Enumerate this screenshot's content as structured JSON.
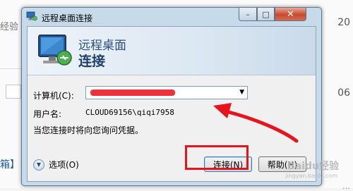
{
  "background": {
    "left_text_1": "经验",
    "left_text_2": "箱】",
    "right_text_1": "20",
    "right_text_2": "06",
    "right_text_3": "…"
  },
  "dialog": {
    "title": "远程桌面连接",
    "titlebar_buttons": {
      "minimize": "–",
      "maximize": "□",
      "close": "✕"
    },
    "banner": {
      "line1": "远程桌面",
      "line2": "连接"
    },
    "computer_label": "计算机(C):",
    "computer_value": "",
    "username_label": "用户名:",
    "username_value": "CLOUD69156\\qiqi7958",
    "hint": "当您连接时将向您询问凭据。",
    "options_label": "选项(O)",
    "connect_button": "连接(N)",
    "help_button": "帮助(H)"
  },
  "watermark": {
    "text": "Baidu经验",
    "sub": "jingyan.baidu.com"
  },
  "colors": {
    "highlight": "#e8141c",
    "titlebar": "#c6daea",
    "close_button": "#c84a2f"
  }
}
